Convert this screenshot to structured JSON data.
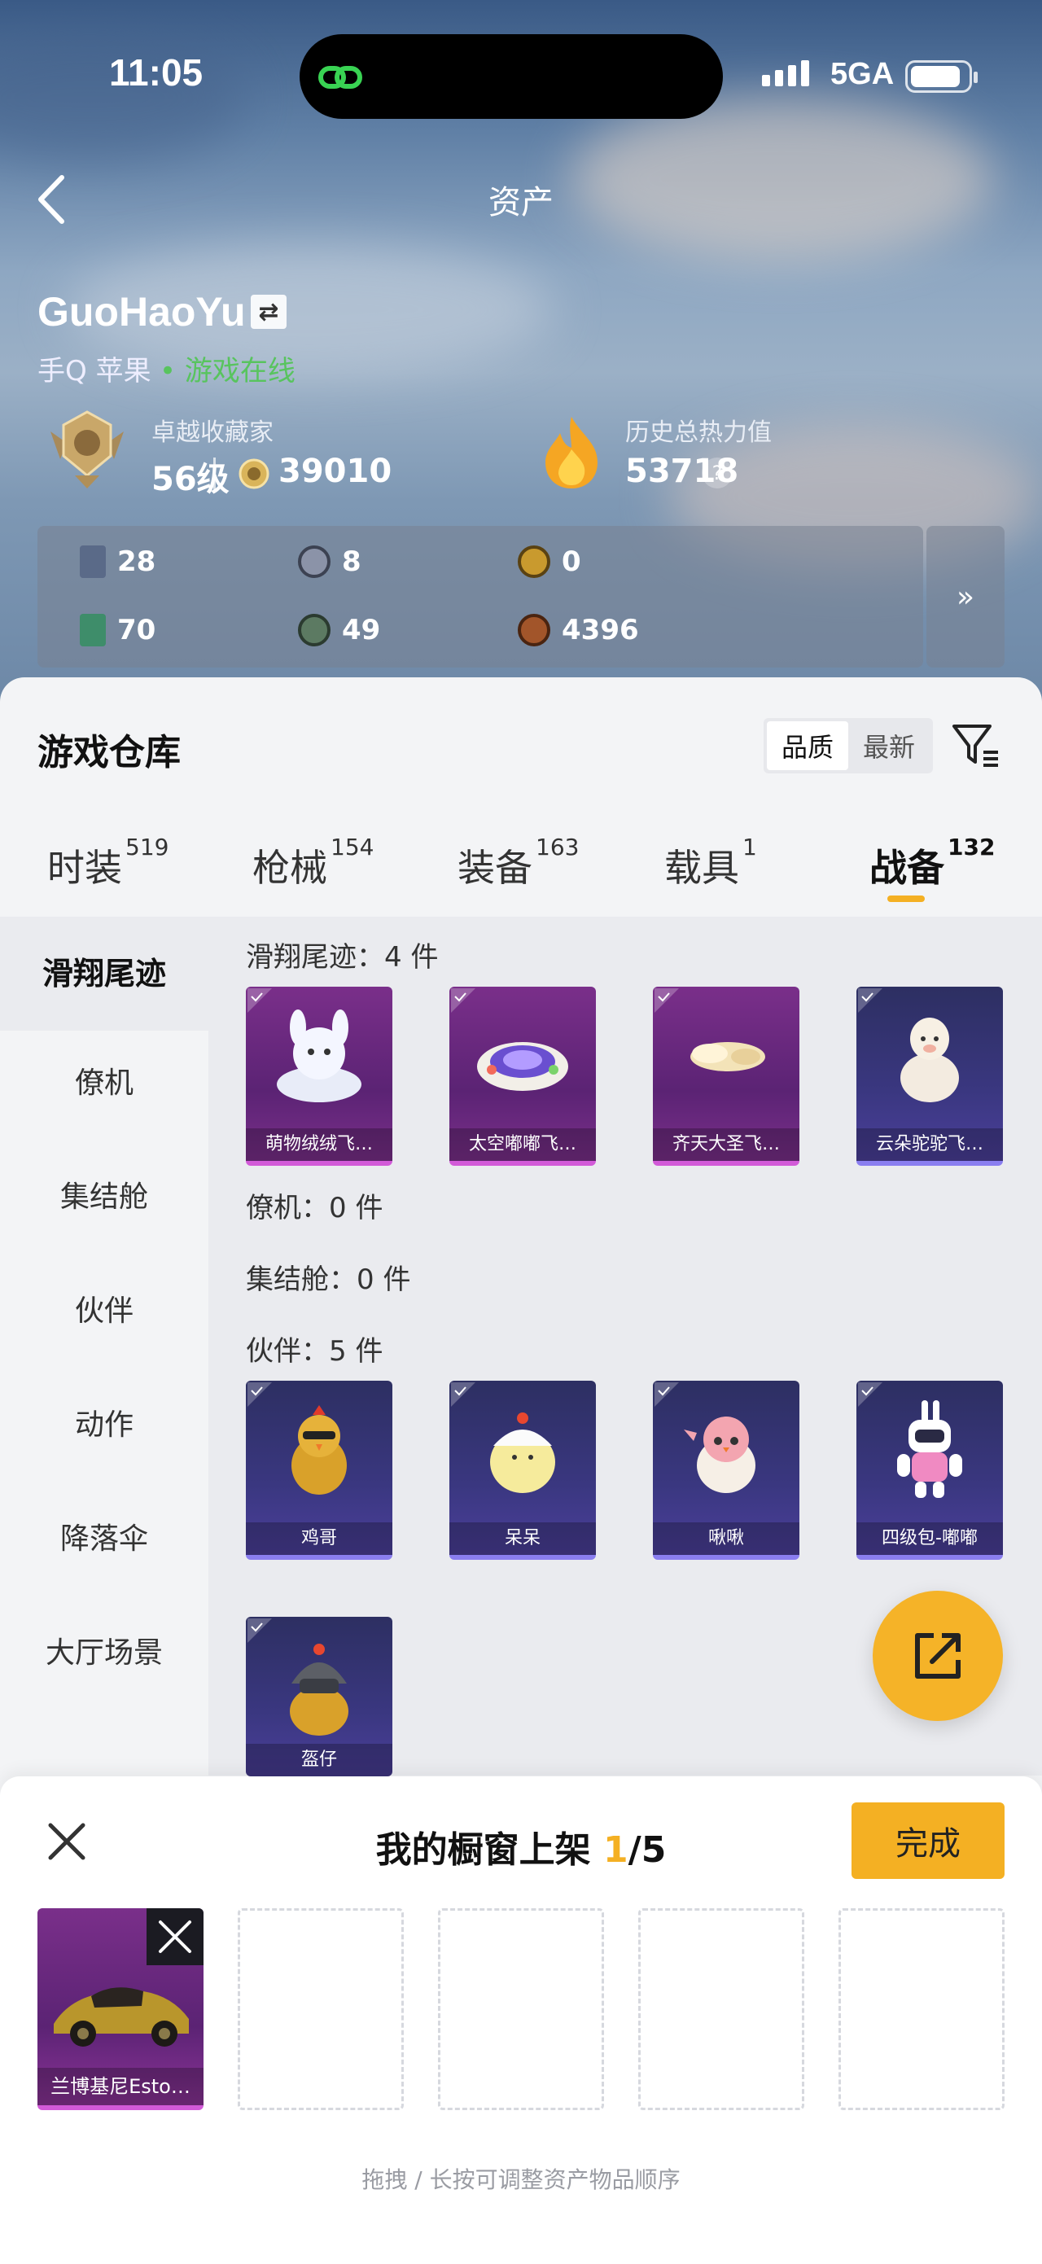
{
  "status": {
    "time": "11:05",
    "network": "5GA"
  },
  "nav": {
    "title": "资产"
  },
  "profile": {
    "name": "GuoHaoYu",
    "switch_glyph": "⇄",
    "platform": "手Q 苹果",
    "online": "• 游戏在线",
    "collector_label": "卓越收藏家",
    "level": "56级",
    "coins": "39010",
    "heat_label": "历史总热力值",
    "heat_value": "53718",
    "help": "?"
  },
  "stats": [
    {
      "value": "28",
      "icon": "card-icon",
      "color": "#5a6a88"
    },
    {
      "value": "8",
      "icon": "silver-coin-icon",
      "color": "#8b93a8"
    },
    {
      "value": "0",
      "icon": "gold-coin-icon",
      "color": "#c99a2e"
    },
    {
      "value": "70",
      "icon": "green-card-icon",
      "color": "#3e8d6a"
    },
    {
      "value": "49",
      "icon": "green-orb-icon",
      "color": "#5c7a62"
    },
    {
      "value": "4396",
      "icon": "bronze-coin-icon",
      "color": "#a2552a"
    }
  ],
  "stats_more": "»",
  "warehouse": {
    "title": "游戏仓库",
    "sort": [
      "品质",
      "最新"
    ],
    "tabs": [
      {
        "label": "时装",
        "count": "519"
      },
      {
        "label": "枪械",
        "count": "154"
      },
      {
        "label": "装备",
        "count": "163"
      },
      {
        "label": "载具",
        "count": "1"
      },
      {
        "label": "战备",
        "count": "132"
      }
    ],
    "categories": [
      "滑翔尾迹",
      "僚机",
      "集结舱",
      "伙伴",
      "动作",
      "降落伞",
      "大厅场景"
    ],
    "sections": {
      "trail_title": "滑翔尾迹：4 件",
      "wingman_title": "僚机：0 件",
      "pod_title": "集结舱：0 件",
      "partner_title": "伙伴：5 件"
    },
    "trail_items": [
      "萌物绒绒飞…",
      "太空嘟嘟飞…",
      "齐天大圣飞…",
      "云朵驼驼飞…"
    ],
    "partner_items": [
      "鸡哥",
      "呆呆",
      "啾啾",
      "四级包-嘟嘟",
      "盔仔"
    ]
  },
  "sheet": {
    "title_prefix": "我的橱窗上架 ",
    "count": "1",
    "title_suffix": "/5",
    "done": "完成",
    "slot_item": "兰博基尼Esto…",
    "hint": "拖拽 / 长按可调整资产物品顺序"
  }
}
